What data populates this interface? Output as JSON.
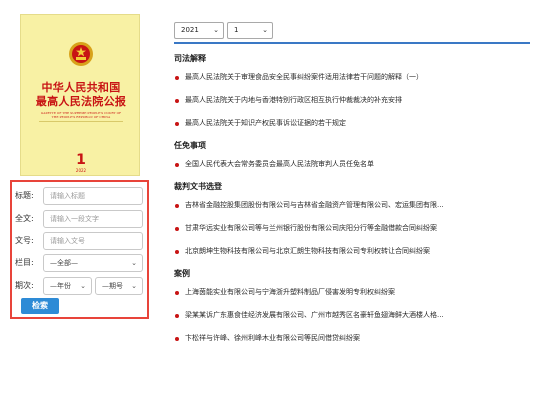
{
  "cover": {
    "title_line1": "中华人民共和国",
    "title_line2": "最高人民法院公报",
    "english_line1": "GAZETTE OF THE SUPREME PEOPLE'S COURT OF",
    "english_line2": "THE PEOPLE'S REPUBLIC OF CHINA",
    "issue": "1",
    "year": "2022"
  },
  "search": {
    "title_label": "标题:",
    "title_placeholder": "请输入标题",
    "fulltext_label": "全文:",
    "fulltext_placeholder": "请输入一段文字",
    "docno_label": "文号:",
    "docno_placeholder": "请输入文号",
    "column_label": "栏目:",
    "column_selected": "—全部—",
    "period_label": "期次:",
    "year_selected": "—年份",
    "issue_selected": "—期号",
    "search_button": "检索"
  },
  "filters": {
    "year_selected": "2021",
    "issue_selected": "1"
  },
  "sections": [
    {
      "title": "司法解释",
      "items": [
        "最高人民法院关于审理食品安全民事纠纷案件适用法律若干问题的解释（一）",
        "最高人民法院关于内地与香港特别行政区相互执行仲裁裁决的补充安排",
        "最高人民法院关于知识产权民事诉讼证据的若干规定"
      ]
    },
    {
      "title": "任免事项",
      "items": [
        "全国人民代表大会常务委员会最高人民法院审判人员任免名单"
      ]
    },
    {
      "title": "裁判文书选登",
      "items": [
        "吉林省金融控股集团股份有限公司与吉林省金融资产管理有限公司、宏运集团有限...",
        "甘肃华远实业有限公司等与兰州银行股份有限公司庆阳分行等金融借款合同纠纷案",
        "北京朗坤生物科技有限公司与北京汇朗生物科技有限公司专利权转让合同纠纷案"
      ]
    },
    {
      "title": "案例",
      "items": [
        "上海茵能实业有限公司与宁海浙升塑料制品厂侵害发明专利权纠纷案",
        "梁某某诉广东惠食佳经济发展有限公司、广州市越秀区名豪轩鱼翅海鲜大酒楼人格...",
        "卞松祥与许峰、徐州利峰木业有限公司等民间借贷纠纷案"
      ]
    }
  ],
  "colors": {
    "accent_red": "#c81414",
    "panel_border": "#e8443a",
    "button_blue": "#2e8bd6",
    "rule_blue": "#3a78c5",
    "cover_yellow": "#f8f1a4"
  },
  "icons": {
    "emblem": "national-emblem-icon",
    "bullet": "red-dot-icon",
    "dropdown": "chevron-down-icon"
  }
}
